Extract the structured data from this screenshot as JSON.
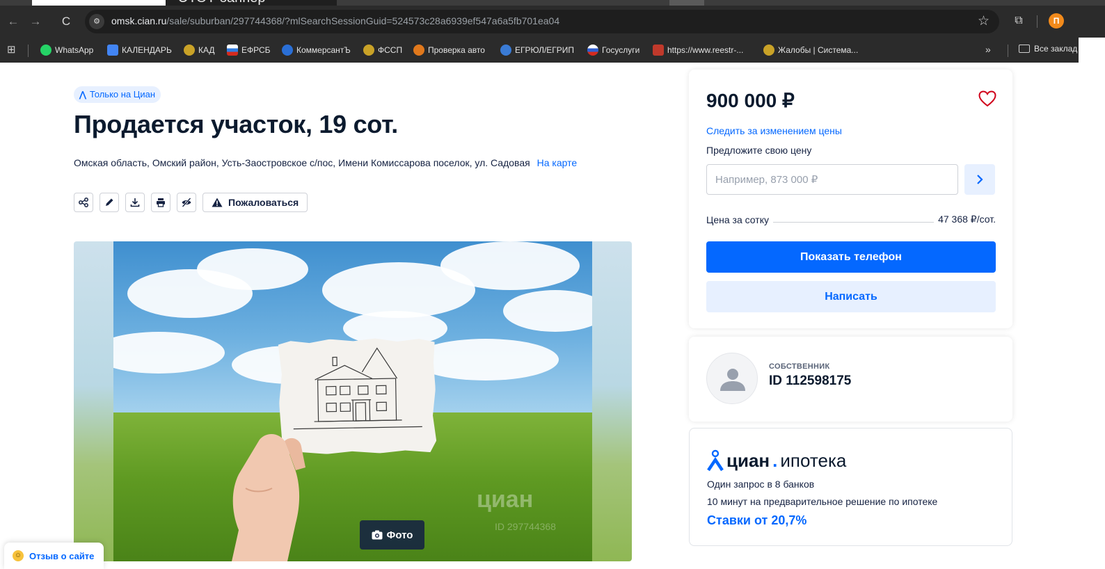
{
  "browser": {
    "tab_title_partial": "ЭТОТ баннер",
    "url_host": "omsk.cian.ru",
    "url_path": "/sale/suburban/297744368/?mlSearchSessionGuid=524573c28a6939ef547a6a5fb701ea04",
    "profile_initial": "П",
    "bookmarks": [
      {
        "label": "WhatsApp",
        "icon": "whatsapp-icon",
        "color": "#25d366"
      },
      {
        "label": "КАЛЕНДАРЬ",
        "icon": "calendar-icon",
        "color": "#4285f4"
      },
      {
        "label": "КАД",
        "icon": "emblem-icon",
        "color": "#c9a227"
      },
      {
        "label": "ЕФРСБ",
        "icon": "flag-icon",
        "color": "#2f7de1"
      },
      {
        "label": "КоммерсантЪ",
        "icon": "kommersant-icon",
        "color": "#2a6fd6"
      },
      {
        "label": "ФССП",
        "icon": "emblem-icon",
        "color": "#c9a227"
      },
      {
        "label": "Проверка авто",
        "icon": "avto-icon",
        "color": "#e0781c"
      },
      {
        "label": "ЕГРЮЛ/ЕГРИП",
        "icon": "nalog-icon",
        "color": "#3a7bd5"
      },
      {
        "label": "Госуслуги",
        "icon": "gosuslugi-icon",
        "color": "#d52b1e"
      },
      {
        "label": "https://www.reestr-...",
        "icon": "reestr-icon",
        "color": "#c0392b"
      },
      {
        "label": "Жалобы | Система...",
        "icon": "emblem-icon",
        "color": "#c9a227"
      }
    ],
    "more_label": "»",
    "all_bookmarks_label": "Все заклад"
  },
  "listing": {
    "badge": "Только на Циан",
    "title": "Продается участок, 19 сот.",
    "address": "Омская область, Омский район, Усть-Заостровское с/пос, Имени Комиссарова поселок, ул. Садовая",
    "map_link": "На карте",
    "complain_label": "Пожаловаться",
    "photo_button": "Фото",
    "watermark": "циан",
    "watermark_id": "ID 297744368"
  },
  "price_card": {
    "price": "900 000 ₽",
    "track_price_link": "Следить за изменением цены",
    "offer_label": "Предложите свою цену",
    "offer_placeholder": "Например, 873 000 ₽",
    "per_sotka_label": "Цена за сотку",
    "per_sotka_value": "47 368 ₽/сот.",
    "show_phone": "Показать телефон",
    "write": "Написать"
  },
  "owner": {
    "role": "СОБСТВЕННИК",
    "id": "ID 112598175"
  },
  "mortgage": {
    "logo_main": "циан",
    "logo_dot": ".",
    "logo_suffix": "ипотека",
    "line1": "Один запрос в 8 банков",
    "line2": "10 минут на предварительное решение по ипотеке",
    "rate": "Ставки от 20,7%"
  },
  "feedback_button": "Отзыв о сайте",
  "colors": {
    "accent": "#0468ff",
    "accent_light": "#e7f0ff",
    "text": "#152242",
    "favorite": "#d0021b"
  }
}
